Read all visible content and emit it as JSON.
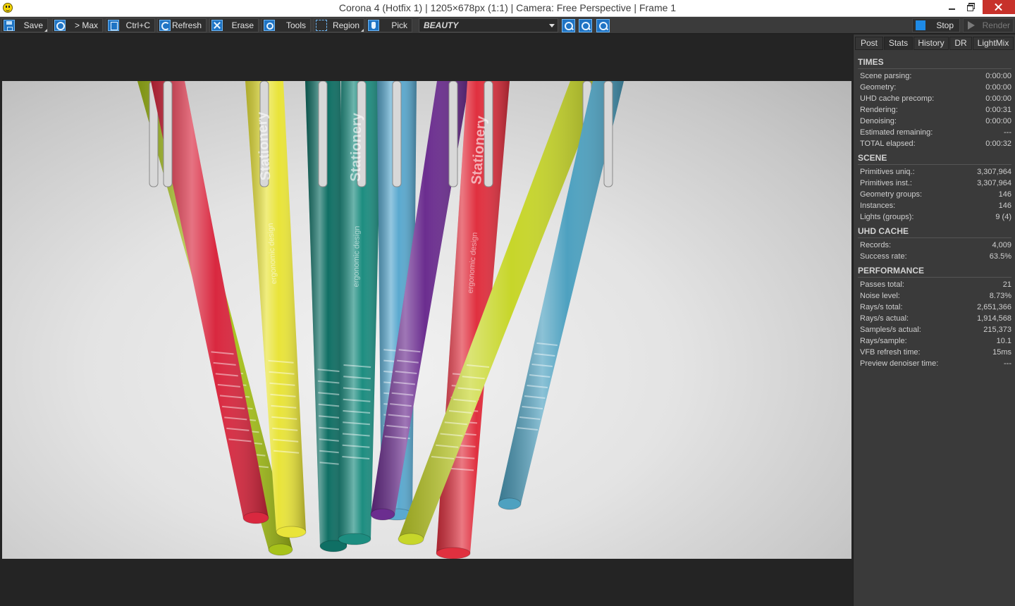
{
  "window": {
    "title": "Corona 4 (Hotfix 1) | 1205×678px (1:1) | Camera: Free Perspective | Frame 1"
  },
  "toolbar": {
    "save": "Save",
    "max": "> Max",
    "copy": "Ctrl+C",
    "refresh": "Refresh",
    "erase": "Erase",
    "tools": "Tools",
    "region": "Region",
    "pick": "Pick",
    "channel": "BEAUTY",
    "stop": "Stop",
    "render": "Render"
  },
  "tabs": [
    "Post",
    "Stats",
    "History",
    "DR",
    "LightMix"
  ],
  "active_tab": "Stats",
  "stats": {
    "times": {
      "title": "TIMES",
      "rows": [
        {
          "k": "Scene parsing:",
          "v": "0:00:00"
        },
        {
          "k": "Geometry:",
          "v": "0:00:00"
        },
        {
          "k": "UHD cache precomp:",
          "v": "0:00:00"
        },
        {
          "k": "Rendering:",
          "v": "0:00:31"
        },
        {
          "k": "Denoising:",
          "v": "0:00:00"
        },
        {
          "k": "Estimated remaining:",
          "v": "---"
        },
        {
          "k": "TOTAL elapsed:",
          "v": "0:00:32"
        }
      ]
    },
    "scene": {
      "title": "SCENE",
      "rows": [
        {
          "k": "Primitives uniq.:",
          "v": "3,307,964"
        },
        {
          "k": "Primitives inst.:",
          "v": "3,307,964"
        },
        {
          "k": "Geometry groups:",
          "v": "146"
        },
        {
          "k": "Instances:",
          "v": "146"
        },
        {
          "k": "Lights (groups):",
          "v": "9 (4)"
        }
      ]
    },
    "uhd": {
      "title": "UHD CACHE",
      "rows": [
        {
          "k": "Records:",
          "v": "4,009"
        },
        {
          "k": "Success rate:",
          "v": "63.5%"
        }
      ]
    },
    "performance": {
      "title": "PERFORMANCE",
      "rows": [
        {
          "k": "Passes total:",
          "v": "21"
        },
        {
          "k": "Noise level:",
          "v": "8.73%"
        },
        {
          "k": "Rays/s total:",
          "v": "2,651,366"
        },
        {
          "k": "Rays/s actual:",
          "v": "1,914,568"
        },
        {
          "k": "Samples/s actual:",
          "v": "215,373"
        },
        {
          "k": "Rays/sample:",
          "v": "10.1"
        },
        {
          "k": "VFB refresh time:",
          "v": "15ms"
        },
        {
          "k": "Preview denoiser time:",
          "v": "---"
        }
      ]
    }
  },
  "render": {
    "pen_print_brand": "Stationery",
    "pen_print_tagline": "ergonomic design",
    "pen_colors": [
      "#a7c21a",
      "#d9283f",
      "#e9e43a",
      "#0f6f64",
      "#1d8d80",
      "#5aa9cf",
      "#6b2d8f",
      "#e0303f",
      "#c7d62a",
      "#4ea1c0"
    ]
  }
}
